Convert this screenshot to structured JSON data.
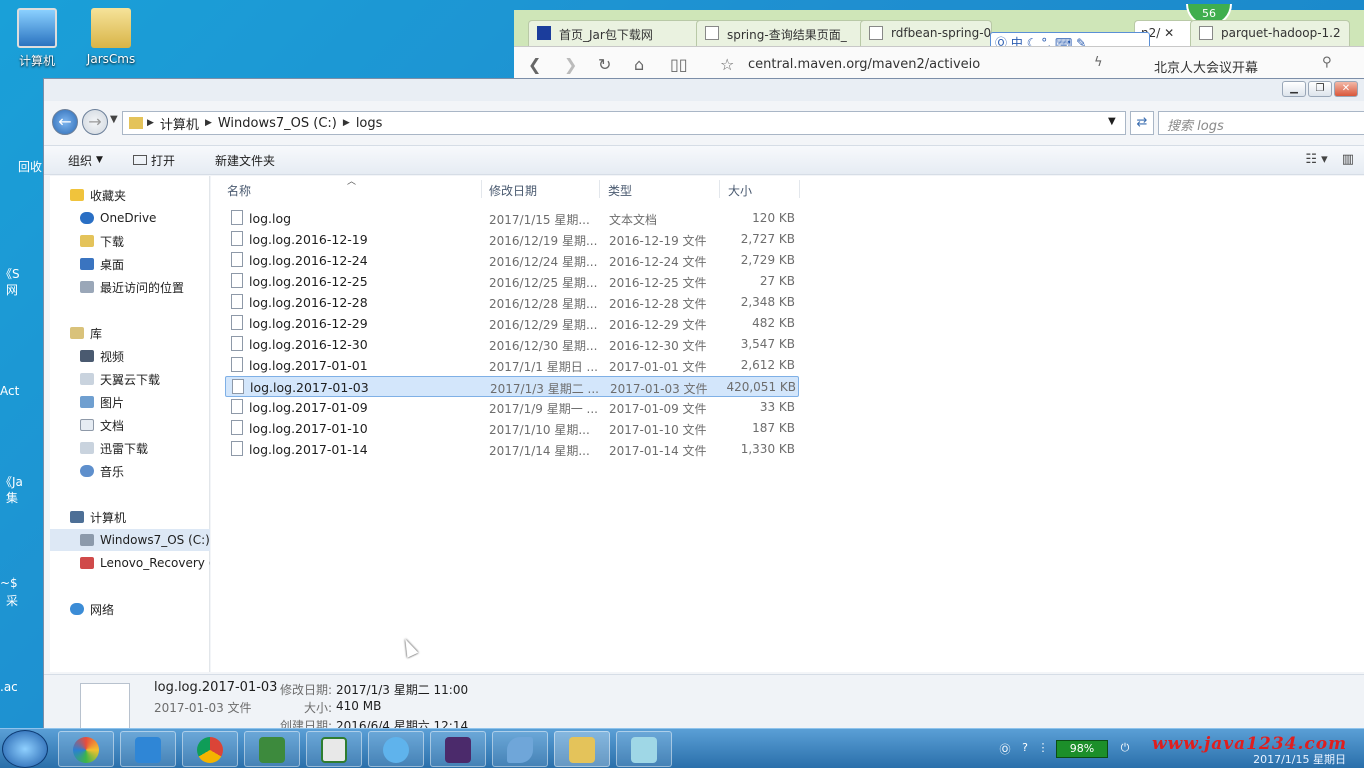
{
  "desktop": {
    "icons": [
      {
        "label": "计算机"
      },
      {
        "label": "JarsCms"
      }
    ],
    "partial_labels": [
      "回收",
      "《S",
      "网",
      "Act",
      "《Ja",
      "集",
      "~$",
      "采",
      ".ac"
    ]
  },
  "browser": {
    "tabs": [
      {
        "label": "首页_Jar包下载网"
      },
      {
        "label": "spring-查询结果页面_"
      },
      {
        "label": "rdfbean-spring-0"
      },
      {
        "label": "n2/"
      },
      {
        "label": "parquet-hadoop-1.2"
      }
    ],
    "url": "central.maven.org/maven2/activeio",
    "search_hint": "北京人大会议开幕",
    "ime_text": "中",
    "badge": "56"
  },
  "explorer": {
    "path": [
      "计算机",
      "Windows7_OS (C:)",
      "logs"
    ],
    "search_placeholder": "搜索 logs",
    "toolbar": {
      "organize": "组织",
      "open": "打开",
      "new_folder": "新建文件夹"
    },
    "sidebar": {
      "favorites": {
        "label": "收藏夹",
        "items": [
          "OneDrive",
          "下载",
          "桌面",
          "最近访问的位置"
        ]
      },
      "libraries": {
        "label": "库",
        "items": [
          "视频",
          "天翼云下载",
          "图片",
          "文档",
          "迅雷下载",
          "音乐"
        ]
      },
      "computer": {
        "label": "计算机",
        "items": [
          "Windows7_OS (C:)",
          "Lenovo_Recovery ("
        ]
      },
      "network": {
        "label": "网络"
      }
    },
    "columns": {
      "name": "名称",
      "date": "修改日期",
      "type": "类型",
      "size": "大小"
    },
    "files": [
      {
        "name": "log.log",
        "date": "2017/1/15 星期...",
        "type": "文本文档",
        "size": "120 KB"
      },
      {
        "name": "log.log.2016-12-19",
        "date": "2016/12/19 星期...",
        "type": "2016-12-19 文件",
        "size": "2,727 KB"
      },
      {
        "name": "log.log.2016-12-24",
        "date": "2016/12/24 星期...",
        "type": "2016-12-24 文件",
        "size": "2,729 KB"
      },
      {
        "name": "log.log.2016-12-25",
        "date": "2016/12/25 星期...",
        "type": "2016-12-25 文件",
        "size": "27 KB"
      },
      {
        "name": "log.log.2016-12-28",
        "date": "2016/12/28 星期...",
        "type": "2016-12-28 文件",
        "size": "2,348 KB"
      },
      {
        "name": "log.log.2016-12-29",
        "date": "2016/12/29 星期...",
        "type": "2016-12-29 文件",
        "size": "482 KB"
      },
      {
        "name": "log.log.2016-12-30",
        "date": "2016/12/30 星期...",
        "type": "2016-12-30 文件",
        "size": "3,547 KB"
      },
      {
        "name": "log.log.2017-01-01",
        "date": "2017/1/1 星期日 ...",
        "type": "2017-01-01 文件",
        "size": "2,612 KB"
      },
      {
        "name": "log.log.2017-01-03",
        "date": "2017/1/3 星期二 ...",
        "type": "2017-01-03 文件",
        "size": "420,051 KB",
        "selected": true
      },
      {
        "name": "log.log.2017-01-09",
        "date": "2017/1/9 星期一 ...",
        "type": "2017-01-09 文件",
        "size": "33 KB"
      },
      {
        "name": "log.log.2017-01-10",
        "date": "2017/1/10 星期...",
        "type": "2017-01-10 文件",
        "size": "187 KB"
      },
      {
        "name": "log.log.2017-01-14",
        "date": "2017/1/14 星期...",
        "type": "2017-01-14 文件",
        "size": "1,330 KB"
      }
    ],
    "details": {
      "name": "log.log.2017-01-03",
      "type": "2017-01-03 文件",
      "modified_label": "修改日期:",
      "modified": "2017/1/3 星期二 11:00",
      "size_label": "大小:",
      "size": "410 MB",
      "created_label": "创建日期:",
      "created": "2016/6/4 星期六 12:14"
    }
  },
  "taskbar": {
    "battery": "98%",
    "watermark": "www.java1234.com",
    "clock_date": "2017/1/15 星期日"
  },
  "colors": {
    "selection": "#d3e6fb",
    "selection_border": "#7fb0e6",
    "desktop": "#1a8fd0",
    "watermark": "#e01e1e"
  }
}
